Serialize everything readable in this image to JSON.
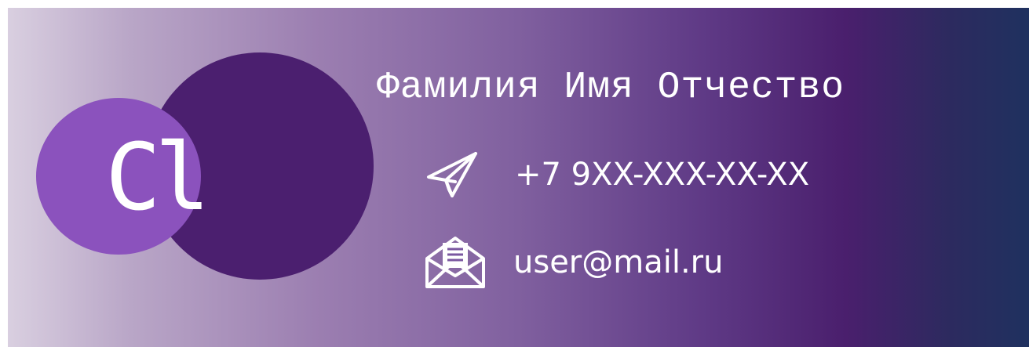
{
  "card": {
    "logo_text": "Cl",
    "full_name": "Фамилия Имя Отчество",
    "phone": "+7 9XX-XXX-XX-XX",
    "email": "user@mail.ru",
    "icons": {
      "phone": "paper-plane-icon",
      "email": "open-envelope-icon"
    },
    "colors": {
      "gradient_start": "#d9cfe0",
      "gradient_mid": "#5f3a86",
      "gradient_end": "#1f315f",
      "circle_big": "#4b1f6f",
      "circle_small": "#8b52bd",
      "text": "#ffffff"
    }
  }
}
